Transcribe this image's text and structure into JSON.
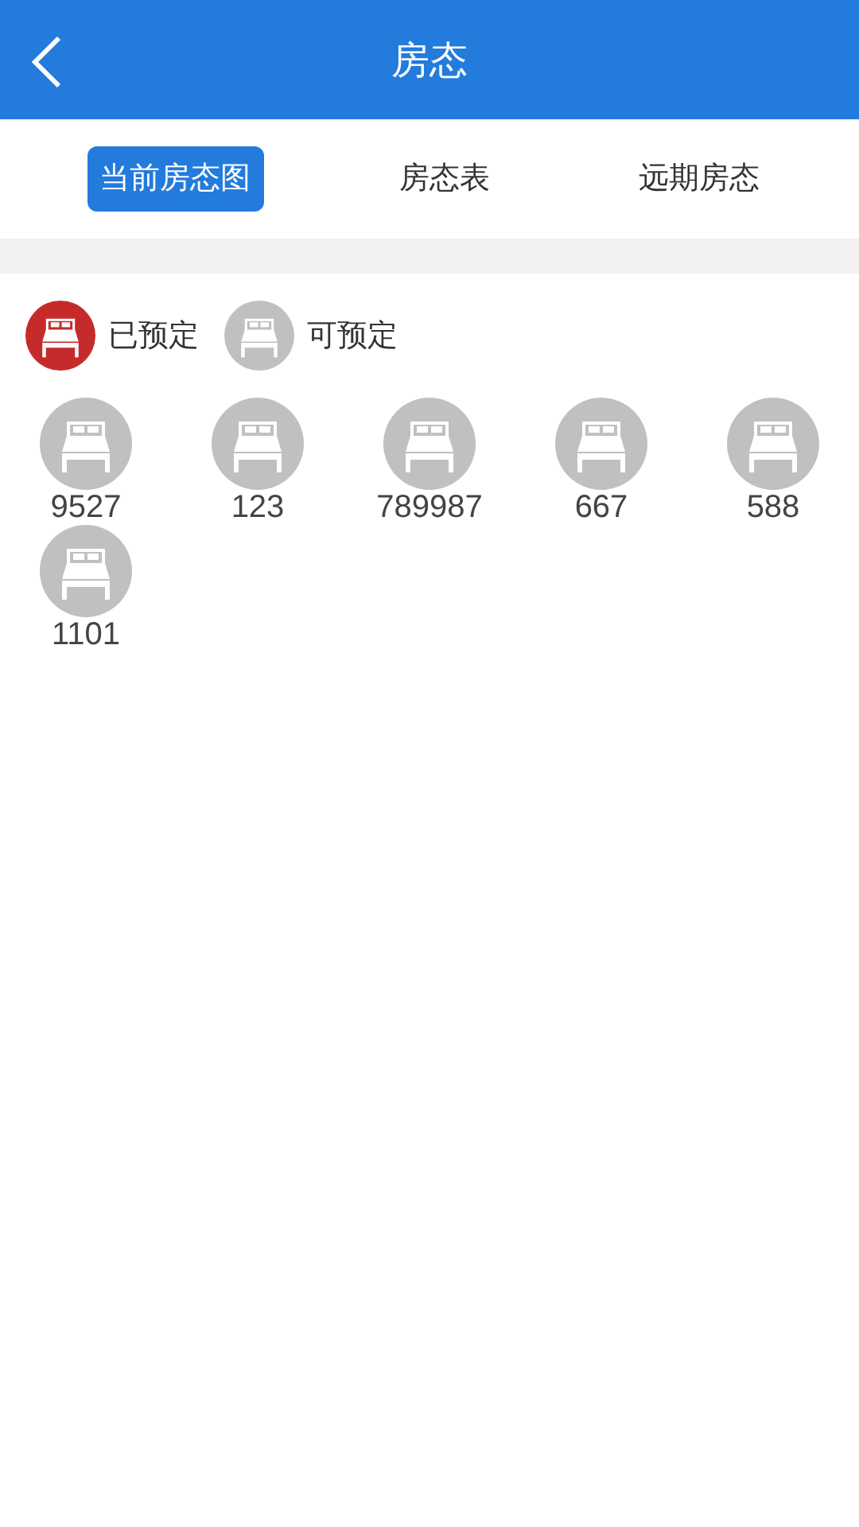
{
  "header": {
    "title": "房态"
  },
  "tabs": [
    {
      "label": "当前房态图",
      "selected": true
    },
    {
      "label": "房态表",
      "selected": false
    },
    {
      "label": "远期房态",
      "selected": false
    }
  ],
  "legend": [
    {
      "label": "已预定",
      "color": "#c62b2b"
    },
    {
      "label": "可预定",
      "color": "#c0c0c0"
    }
  ],
  "rooms": [
    {
      "number": "9527",
      "booked": false
    },
    {
      "number": "123",
      "booked": false
    },
    {
      "number": "789987",
      "booked": false
    },
    {
      "number": "667",
      "booked": false
    },
    {
      "number": "588",
      "booked": false
    },
    {
      "number": "1101",
      "booked": false
    }
  ]
}
